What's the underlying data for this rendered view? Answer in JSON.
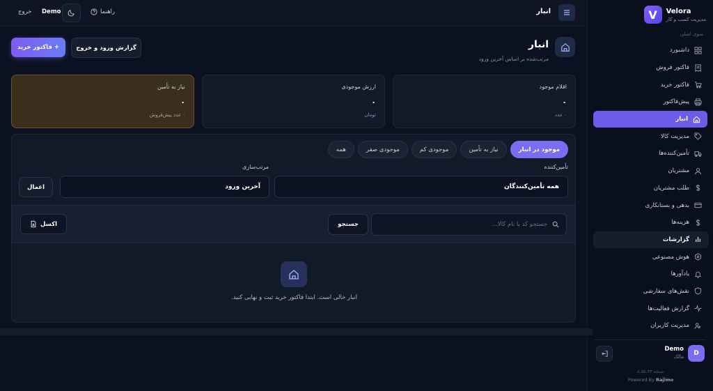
{
  "brand": {
    "name": "Velora",
    "subtitle": "مدیریت کسب و کار",
    "logo_letter": "V"
  },
  "sidebar": {
    "menu_label": "منوی اصلی",
    "items": [
      {
        "label": "داشبورد",
        "icon": "dashboard-icon"
      },
      {
        "label": "فاکتور فروش",
        "icon": "receipt-icon"
      },
      {
        "label": "فاکتور خرید",
        "icon": "cart-icon"
      },
      {
        "label": "پیش‌فاکتور",
        "icon": "printer-icon"
      },
      {
        "label": "انبار",
        "icon": "home-icon"
      },
      {
        "label": "مدیریت کالا",
        "icon": "tag-icon"
      },
      {
        "label": "تأمین‌کننده‌ها",
        "icon": "truck-icon"
      },
      {
        "label": "مشتریان",
        "icon": "user-icon"
      },
      {
        "label": "طلب مشتریان",
        "icon": "dollar-icon"
      },
      {
        "label": "بدهی و بستانکاری",
        "icon": "credit-card-icon"
      },
      {
        "label": "هزینه‌ها",
        "icon": "dollar-icon"
      },
      {
        "label": "گزارشات",
        "icon": "bar-chart-icon"
      },
      {
        "label": "هوش مصنوعی",
        "icon": "ai-icon"
      },
      {
        "label": "یادآورها",
        "icon": "bell-icon"
      },
      {
        "label": "نقش‌های سفارشی",
        "icon": "shield-icon"
      },
      {
        "label": "گزارش فعالیت‌ها",
        "icon": "activity-icon"
      },
      {
        "label": "مدیریت کاربران",
        "icon": "users-icon"
      }
    ],
    "user": {
      "name": "Demo",
      "role": "مالک",
      "avatar_letter": "D"
    },
    "version": "نسخه ۵.۵۵.۴۳",
    "powered_prefix": "Powered By",
    "powered_brand": "Rajimo"
  },
  "topbar": {
    "title": "انبار",
    "logout_label": "خروج",
    "user_name": "Demo",
    "help_label": "راهنما"
  },
  "page": {
    "title": "انبار",
    "subtitle": "مرتب‌شده بر اساس آخرین ورود",
    "primary_button": "+ فاکتور خرید",
    "secondary_button": "گزارش ورود و خروج"
  },
  "stats": [
    {
      "label": "اقلام موجود",
      "value": "۰",
      "note": "۰ عدد"
    },
    {
      "label": "ارزش موجودی",
      "value": "۰",
      "note": "تومان"
    },
    {
      "label": "نیاز به تأمین",
      "value": "۰",
      "note": "۰ عدد پیش‌فروش"
    }
  ],
  "filters": {
    "tabs": [
      "موجود در انبار",
      "نیاز به تأمین",
      "موجودی کم",
      "موجودی صفر",
      "همه"
    ],
    "supplier_label": "تأمین‌کننده",
    "supplier_value": "همه تأمین‌کنندگان",
    "sort_label": "مرتب‌سازی",
    "sort_value": "آخرین ورود",
    "apply_label": "اعمال"
  },
  "search": {
    "placeholder": "جستجو کد یا نام کالا...",
    "button_label": "جستجو",
    "excel_label": "اکسل"
  },
  "empty_state": {
    "message": "انبار خالی است. ابتدا فاکتور خرید ثبت و نهایی کنید."
  },
  "colors": {
    "accent": "#7c6cf0",
    "background": "#0b1120",
    "warning_card": "#3a2e1c"
  }
}
